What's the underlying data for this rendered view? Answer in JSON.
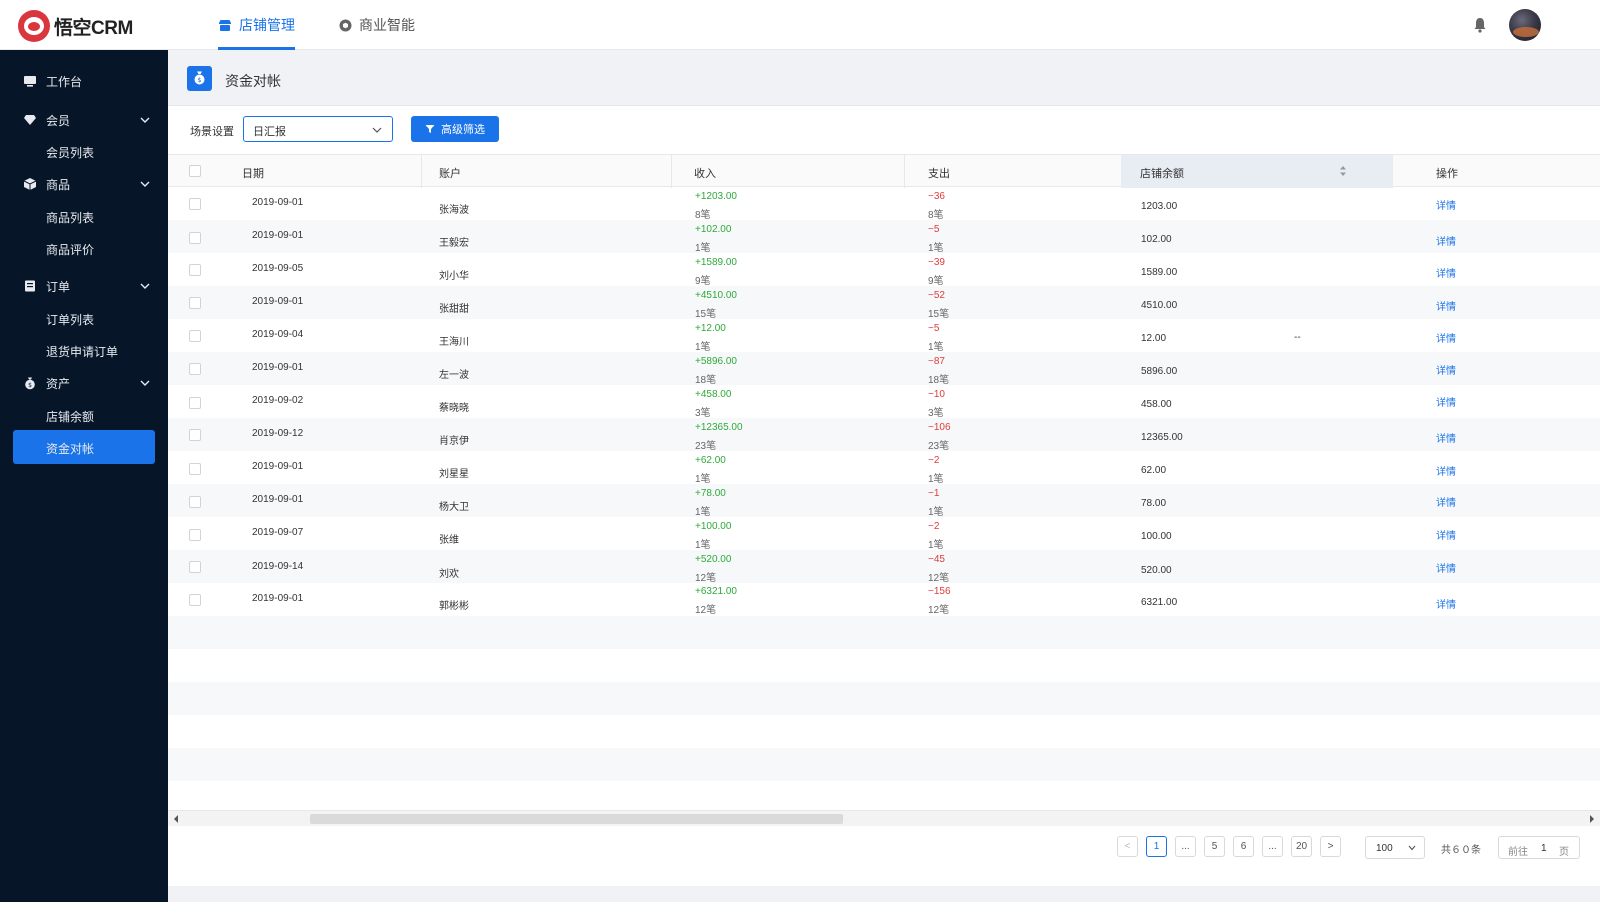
{
  "app": {
    "brand": "悟空CRM"
  },
  "top_tabs": [
    {
      "label": "店铺管理",
      "icon": "store-icon",
      "active": true
    },
    {
      "label": "商业智能",
      "icon": "cube-icon",
      "active": false
    }
  ],
  "sidebar": {
    "workbench": "工作台",
    "members": {
      "label": "会员",
      "items": [
        "会员列表"
      ]
    },
    "products": {
      "label": "商品",
      "items": [
        "商品列表",
        "商品评价"
      ]
    },
    "orders": {
      "label": "订单",
      "items": [
        "订单列表",
        "退货申请订单"
      ]
    },
    "assets": {
      "label": "资产",
      "items": [
        "店铺余额",
        "资金对帐"
      ]
    },
    "active_item": "资金对帐"
  },
  "page": {
    "title": "资金对帐"
  },
  "filters": {
    "scene_label": "场景设置",
    "scene_value": "日汇报",
    "advanced_button": "高级筛选"
  },
  "table": {
    "columns": [
      "日期",
      "账户",
      "收入",
      "支出",
      "店铺余额",
      "操作"
    ],
    "action_label": "详情",
    "rows": [
      {
        "date": "2019-09-01",
        "account": "张海波",
        "income": "+1203.00",
        "income_count": "8笔",
        "expense": "−36",
        "expense_count": "8笔",
        "balance": "1203.00",
        "extra": ""
      },
      {
        "date": "2019-09-01",
        "account": "王毅宏",
        "income": "+102.00",
        "income_count": "1笔",
        "expense": "−5",
        "expense_count": "1笔",
        "balance": "102.00",
        "extra": ""
      },
      {
        "date": "2019-09-05",
        "account": "刘小华",
        "income": "+1589.00",
        "income_count": "9笔",
        "expense": "−39",
        "expense_count": "9笔",
        "balance": "1589.00",
        "extra": ""
      },
      {
        "date": "2019-09-01",
        "account": "张甜甜",
        "income": "+4510.00",
        "income_count": "15笔",
        "expense": "−52",
        "expense_count": "15笔",
        "balance": "4510.00",
        "extra": ""
      },
      {
        "date": "2019-09-04",
        "account": "王海川",
        "income": "+12.00",
        "income_count": "1笔",
        "expense": "−5",
        "expense_count": "1笔",
        "balance": "12.00",
        "extra": "--"
      },
      {
        "date": "2019-09-01",
        "account": "左一波",
        "income": "+5896.00",
        "income_count": "18笔",
        "expense": "−87",
        "expense_count": "18笔",
        "balance": "5896.00",
        "extra": ""
      },
      {
        "date": "2019-09-02",
        "account": "蔡晓晓",
        "income": "+458.00",
        "income_count": "3笔",
        "expense": "−10",
        "expense_count": "3笔",
        "balance": "458.00",
        "extra": ""
      },
      {
        "date": "2019-09-12",
        "account": "肖京伊",
        "income": "+12365.00",
        "income_count": "23笔",
        "expense": "−106",
        "expense_count": "23笔",
        "balance": "12365.00",
        "extra": ""
      },
      {
        "date": "2019-09-01",
        "account": "刘星星",
        "income": "+62.00",
        "income_count": "1笔",
        "expense": "−2",
        "expense_count": "1笔",
        "balance": "62.00",
        "extra": ""
      },
      {
        "date": "2019-09-01",
        "account": "杨大卫",
        "income": "+78.00",
        "income_count": "1笔",
        "expense": "−1",
        "expense_count": "1笔",
        "balance": "78.00",
        "extra": ""
      },
      {
        "date": "2019-09-07",
        "account": "张维",
        "income": "+100.00",
        "income_count": "1笔",
        "expense": "−2",
        "expense_count": "1笔",
        "balance": "100.00",
        "extra": ""
      },
      {
        "date": "2019-09-14",
        "account": "刘欢",
        "income": "+520.00",
        "income_count": "12笔",
        "expense": "−45",
        "expense_count": "12笔",
        "balance": "520.00",
        "extra": ""
      },
      {
        "date": "2019-09-01",
        "account": "郭彬彬",
        "income": "+6321.00",
        "income_count": "12笔",
        "expense": "−156",
        "expense_count": "12笔",
        "balance": "6321.00",
        "extra": ""
      }
    ]
  },
  "pagination": {
    "prev": "<",
    "pages": [
      "1",
      "...",
      "5",
      "6",
      "...",
      "20"
    ],
    "current": "1",
    "next": ">",
    "page_size": "100",
    "total": "共６０条",
    "goto_prefix": "前往",
    "goto_value": "1",
    "goto_suffix": "页"
  },
  "colors": {
    "accent": "#1a73e8",
    "sidebar": "#061628",
    "income": "#2eaa3a",
    "expense": "#e03c3c"
  }
}
